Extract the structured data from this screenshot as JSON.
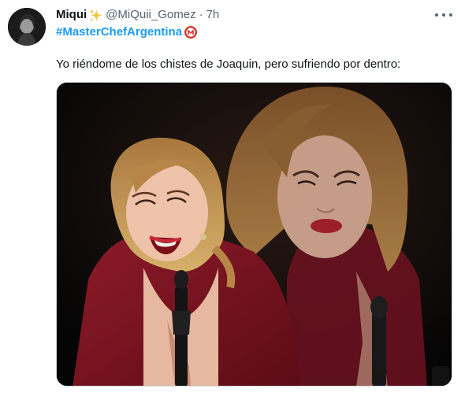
{
  "tweet": {
    "author_name": "Miqui",
    "handle": "@MiQuii_Gomez",
    "separator": "·",
    "time": "7h",
    "hashtag": "#MasterChefArgentina",
    "text": "Yo riéndome de los chistes de Joaquin, pero sufriendo por dentro:"
  },
  "icons": {
    "author_emoji": "sparkles-icon",
    "hashtag_emoji": "masterchef-hashflag-icon",
    "menu": "more-icon"
  },
  "colors": {
    "link": "#1d9bf0",
    "secondary_text": "#536471",
    "dress": "#7a1420"
  }
}
